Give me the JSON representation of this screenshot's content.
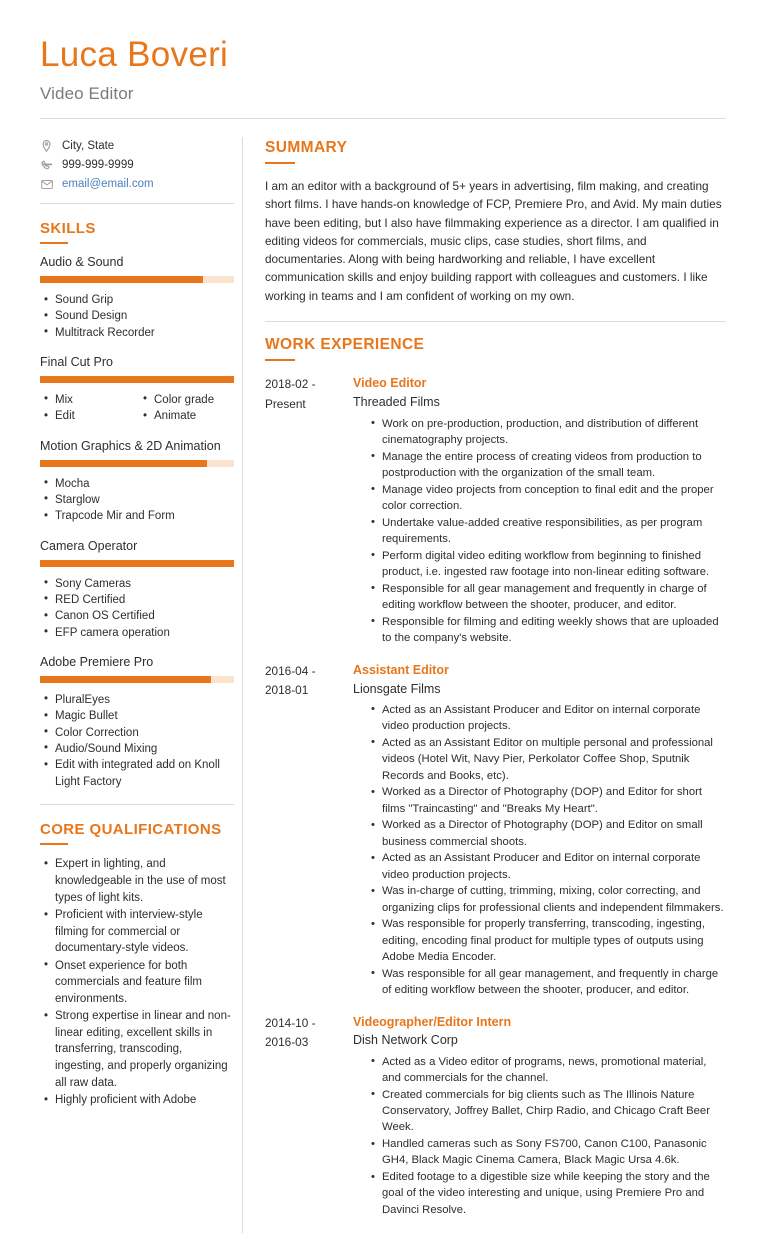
{
  "header": {
    "name": "Luca Boveri",
    "job_title": "Video Editor",
    "accent_color": "#e8761a",
    "link_color": "#4a7fbd"
  },
  "contact": {
    "items": [
      {
        "icon": "map-pin-icon",
        "text": "City, State",
        "type": "location"
      },
      {
        "icon": "phone-icon",
        "text": "999-999-9999",
        "type": "phone"
      },
      {
        "icon": "envelope-icon",
        "text": "email@email.com",
        "type": "email"
      }
    ]
  },
  "skills": {
    "heading": "SKILLS",
    "groups": [
      {
        "name": "Audio & Sound",
        "level": 84,
        "columns": 1,
        "items": [
          "Sound Grip",
          "Sound Design",
          "Multitrack Recorder"
        ]
      },
      {
        "name": "Final Cut Pro",
        "level": 100,
        "columns": 2,
        "items": [
          "Mix",
          "Edit",
          "Color grade",
          "Animate"
        ]
      },
      {
        "name": "Motion Graphics & 2D Animation",
        "level": 86,
        "columns": 1,
        "items": [
          "Mocha",
          "Starglow",
          "Trapcode Mir and Form"
        ]
      },
      {
        "name": "Camera Operator",
        "level": 100,
        "columns": 1,
        "items": [
          "Sony Cameras",
          "RED Certified",
          "Canon OS Certified",
          "EFP camera operation"
        ]
      },
      {
        "name": "Adobe Premiere Pro",
        "level": 88,
        "columns": 1,
        "items": [
          "PluralEyes",
          "Magic Bullet",
          "Color Correction",
          "Audio/Sound Mixing",
          "Edit with integrated add on Knoll Light Factory"
        ]
      }
    ]
  },
  "core_qualifications": {
    "heading": "CORE QUALIFICATIONS",
    "items": [
      "Expert in lighting, and knowledgeable in the use of most types of light kits.",
      "Proficient with interview-style filming for commercial or documentary-style videos.",
      "Onset experience for both commercials and feature film environments.",
      "Strong expertise in linear and non-linear editing, excellent skills in transferring, transcoding, ingesting, and properly organizing all raw data.",
      "Highly proficient with Adobe"
    ]
  },
  "summary": {
    "heading": "SUMMARY",
    "text": "I am an editor with a background of 5+ years in advertising, film making, and creating short films. I have hands-on knowledge of FCP, Premiere Pro, and Avid. My main duties have been editing, but I also have filmmaking experience as a director. I am qualified in editing videos for commercials, music clips, case studies, short films, and documentaries. Along with being hardworking and reliable, I have excellent communication skills and enjoy building rapport with colleagues and customers. I like working in teams and I am confident of working on my own."
  },
  "work_experience": {
    "heading": "WORK EXPERIENCE",
    "jobs": [
      {
        "date_start": "2018-02 -",
        "date_end": "Present",
        "role": "Video Editor",
        "company": "Threaded Films",
        "bullets": [
          "Work on pre-production, production, and distribution of different cinematography projects.",
          "Manage the entire process of creating videos from production to postproduction with the organization of the small team.",
          "Manage video projects from conception to final edit and the proper color correction.",
          "Undertake value-added creative responsibilities, as per program requirements.",
          "Perform digital video editing workflow from beginning to finished product, i.e. ingested raw footage into non-linear editing software.",
          "Responsible for all gear management and frequently in charge of editing workflow between the shooter, producer, and editor.",
          "Responsible for filming and editing weekly shows that are uploaded to the company's website."
        ]
      },
      {
        "date_start": "2016-04 -",
        "date_end": "2018-01",
        "role": "Assistant Editor",
        "company": "Lionsgate Films",
        "bullets": [
          "Acted as an Assistant Producer and Editor on internal corporate video production projects.",
          "Acted as an Assistant Editor on multiple personal and professional videos (Hotel Wit, Navy Pier, Perkolator Coffee Shop, Sputnik Records and Books, etc).",
          "Worked as a Director of Photography (DOP) and Editor for short films \"Traincasting\" and \"Breaks My Heart\".",
          "Worked as a Director of Photography (DOP) and Editor on small business commercial shoots.",
          "Acted as an Assistant Producer and Editor on internal corporate video production projects.",
          "Was in-charge of cutting, trimming, mixing, color correcting, and organizing clips for professional clients and independent filmmakers.",
          "Was responsible for properly transferring, transcoding, ingesting, editing, encoding final product for multiple types of outputs using Adobe Media Encoder.",
          "Was responsible for all gear management, and frequently in charge of editing workflow between the shooter, producer, and editor."
        ]
      },
      {
        "date_start": "2014-10 -",
        "date_end": "2016-03",
        "role": "Videographer/Editor Intern",
        "company": "Dish Network Corp",
        "bullets": [
          "Acted as a Video editor of programs, news, promotional material, and commercials for the channel.",
          "Created commercials for big clients such as The Illinois Nature Conservatory, Joffrey Ballet, Chirp Radio, and Chicago Craft Beer Week.",
          "Handled cameras such as Sony FS700, Canon C100, Panasonic GH4, Black Magic Cinema Camera, Black Magic Ursa 4.6k.",
          "Edited footage to a digestible size while keeping the story and the goal of the video interesting and unique, using Premiere Pro and Davinci Resolve."
        ]
      }
    ]
  }
}
